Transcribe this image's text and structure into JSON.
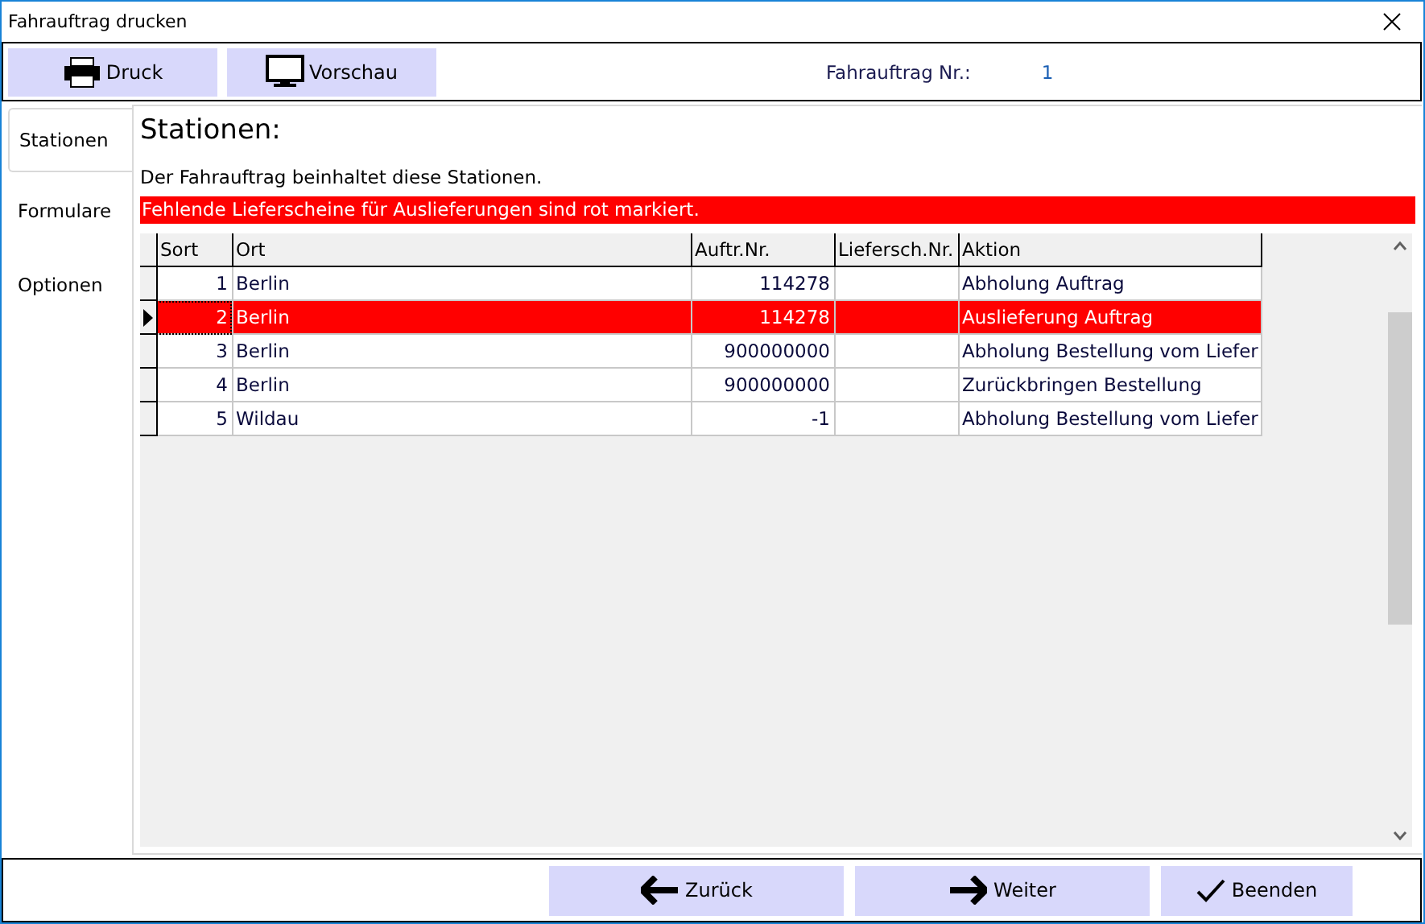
{
  "window": {
    "title": "Fahrauftrag drucken"
  },
  "toolbar": {
    "buttons": [
      {
        "kind": "print",
        "label": "Druck"
      },
      {
        "kind": "preview",
        "label": "Vorschau"
      }
    ],
    "order_label": "Fahrauftrag Nr.:",
    "order_value": "1"
  },
  "tabs": [
    {
      "label": "Stationen",
      "selected": true
    },
    {
      "label": "Formulare",
      "selected": false
    },
    {
      "label": "Optionen",
      "selected": false
    }
  ],
  "heading": "Stationen:",
  "description": "Der Fahrauftrag beinhaltet diese Stationen.",
  "warning": "Fehlende Lieferscheine für Auslieferungen sind rot markiert.",
  "table": {
    "columns": [
      "Sort",
      "Ort",
      "Auftr.Nr.",
      "Liefersch.Nr.",
      "Aktion"
    ],
    "rows": [
      {
        "cells": [
          "1",
          "Berlin",
          "114278",
          "",
          "Abholung Auftrag"
        ],
        "selected": false,
        "missing": false
      },
      {
        "cells": [
          "2",
          "Berlin",
          "114278",
          "",
          "Auslieferung Auftrag"
        ],
        "selected": true,
        "missing": true
      },
      {
        "cells": [
          "3",
          "Berlin",
          "900000000",
          "",
          "Abholung Bestellung vom Liefer"
        ],
        "selected": false,
        "missing": false
      },
      {
        "cells": [
          "4",
          "Berlin",
          "900000000",
          "",
          "Zurückbringen Bestellung"
        ],
        "selected": false,
        "missing": false
      },
      {
        "cells": [
          "5",
          "Wildau",
          "-1",
          "",
          "Abholung Bestellung vom Liefer"
        ],
        "selected": false,
        "missing": false
      }
    ]
  },
  "footer": {
    "buttons": [
      {
        "kind": "back",
        "label": "Zurück"
      },
      {
        "kind": "next",
        "label": "Weiter"
      },
      {
        "kind": "finish",
        "label": "Beenden"
      }
    ]
  }
}
